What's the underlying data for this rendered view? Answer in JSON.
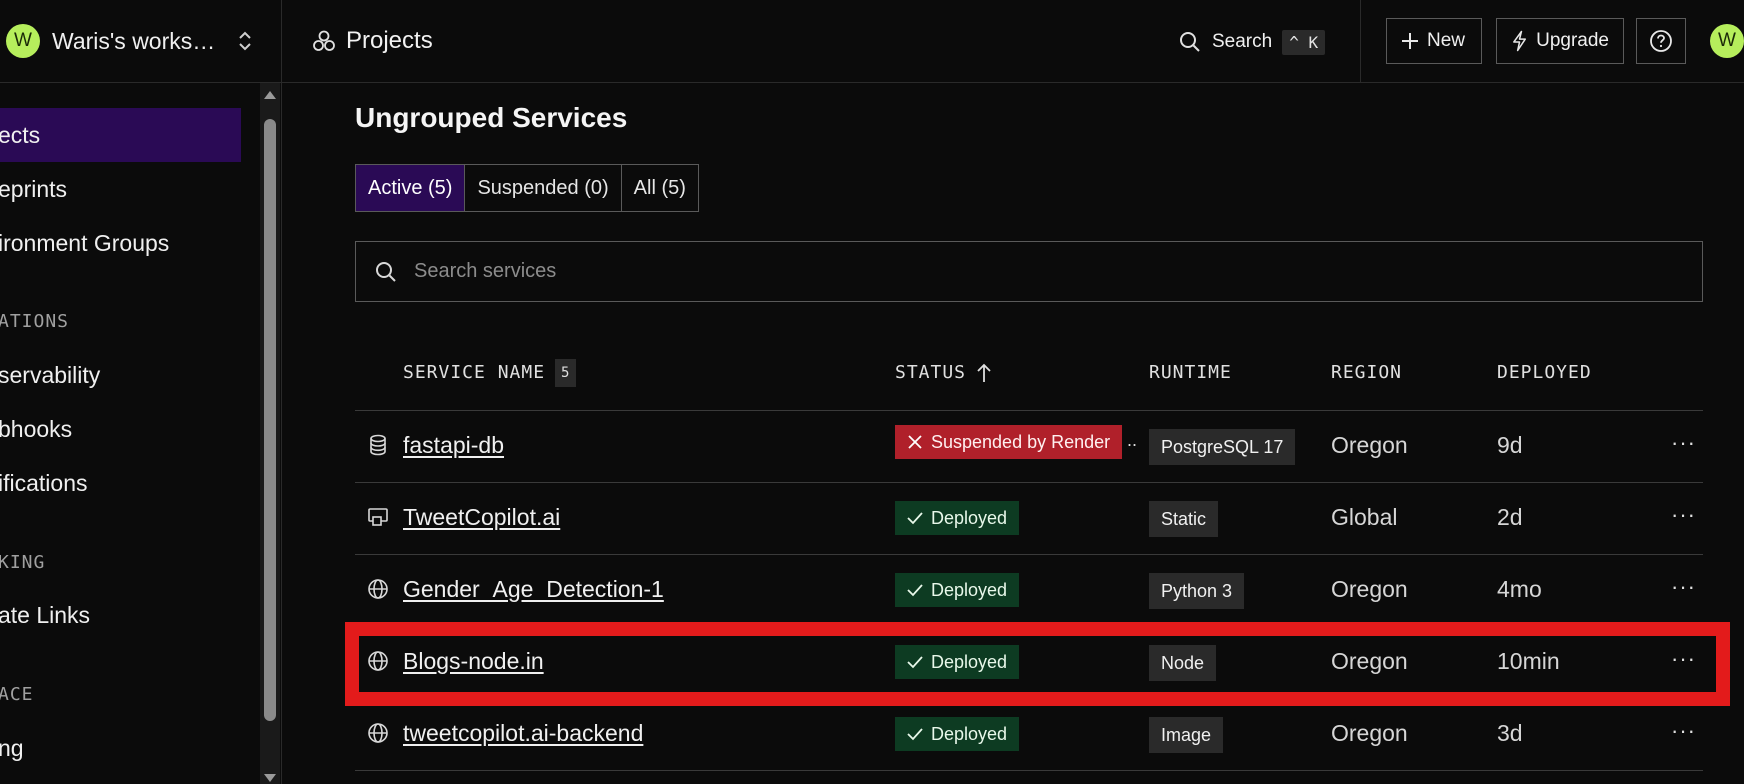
{
  "header": {
    "workspace_avatar": "W",
    "workspace_name": "Waris's works…",
    "breadcrumb": "Projects",
    "search_label": "Search",
    "search_shortcut": "^ K",
    "new_label": "New",
    "upgrade_label": "Upgrade",
    "user_avatar": "W"
  },
  "sidebar": {
    "items": [
      {
        "label": "ects",
        "active": true
      },
      {
        "label": "eprints"
      },
      {
        "label": "ironment Groups"
      }
    ],
    "section_integrations": "ATIONS",
    "integration_items": [
      {
        "label": "servability"
      },
      {
        "label": "bhooks"
      },
      {
        "label": "ifications"
      }
    ],
    "section_networking": "KING",
    "networking_items": [
      {
        "label": "ate Links"
      }
    ],
    "section_workspace": "ACE",
    "workspace_items": [
      {
        "label": "ng"
      }
    ]
  },
  "main": {
    "title": "Ungrouped Services",
    "tabs": [
      {
        "label": "Active (5)",
        "active": true
      },
      {
        "label": "Suspended (0)"
      },
      {
        "label": "All (5)"
      }
    ],
    "search_placeholder": "Search services",
    "columns": {
      "service_name": "SERVICE NAME",
      "service_count": "5",
      "status": "STATUS",
      "runtime": "RUNTIME",
      "region": "REGION",
      "deployed": "DEPLOYED"
    },
    "rows": [
      {
        "icon": "database-icon",
        "name": "fastapi-db",
        "status": "Suspended by Render",
        "status_kind": "suspended",
        "runtime": "PostgreSQL 17",
        "region": "Oregon",
        "deployed": "9d",
        "more": "···"
      },
      {
        "icon": "static-site-icon",
        "name": "TweetCopilot.ai",
        "status": "Deployed",
        "status_kind": "deployed",
        "runtime": "Static",
        "region": "Global",
        "deployed": "2d",
        "more": "···"
      },
      {
        "icon": "globe-icon",
        "name": "Gender_Age_Detection-1",
        "status": "Deployed",
        "status_kind": "deployed",
        "runtime": "Python 3",
        "region": "Oregon",
        "deployed": "4mo",
        "more": "···"
      },
      {
        "icon": "globe-icon",
        "name": "Blogs-node.in",
        "status": "Deployed",
        "status_kind": "deployed",
        "runtime": "Node",
        "region": "Oregon",
        "deployed": "10min",
        "more": "···"
      },
      {
        "icon": "globe-icon",
        "name": "tweetcopilot.ai-backend",
        "status": "Deployed",
        "status_kind": "deployed",
        "runtime": "Image",
        "region": "Oregon",
        "deployed": "3d",
        "more": "···"
      }
    ]
  },
  "colors": {
    "accent_active": "#2a0a55",
    "deployed_bg": "#0d3b22",
    "suspended_bg": "#b0202a",
    "highlight_border": "#e31b1b",
    "avatar": "#b6ee5c"
  }
}
